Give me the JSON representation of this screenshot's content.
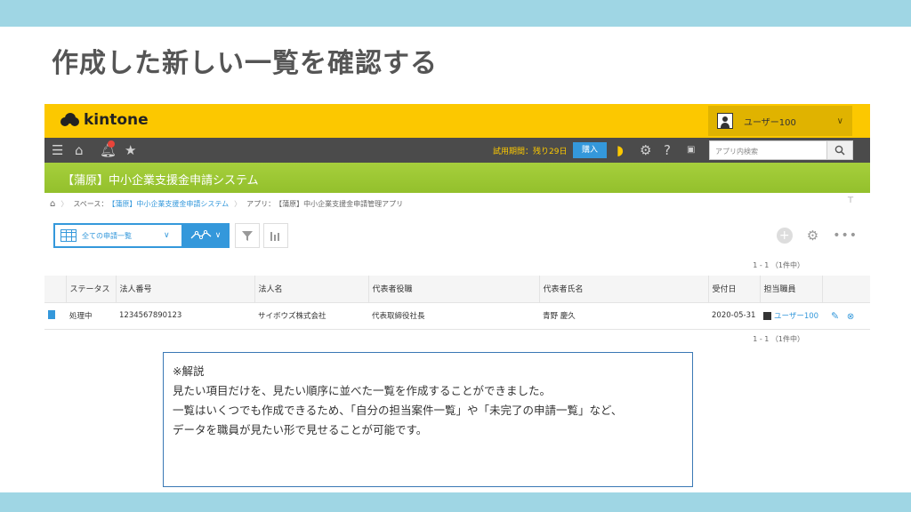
{
  "slide": {
    "title": "作成した新しい一覧を確認する"
  },
  "app": {
    "logo_text": "kintone",
    "user_name": "ユーザー100",
    "trial_text": "試用期間：残り29日",
    "buy_label": "購入",
    "search_placeholder": "アプリ内検索",
    "space_title": "【蒲原】中小企業支援金申請システム",
    "breadcrumb": {
      "space": "スペース：",
      "space_link": "【蒲原】中小企業支援金申請システム",
      "app": "アプリ：",
      "app_link": "【蒲原】中小企業支援金申請管理アプリ"
    },
    "view_label": "全ての申請一覧",
    "pager_top": "1 - 1 （1件中）",
    "pager_bottom": "1 - 1 （1件中）",
    "table": {
      "headers": [
        "ステータス",
        "法人番号",
        "法人名",
        "代表者役職",
        "代表者氏名",
        "受付日",
        "担当職員"
      ],
      "rows": [
        {
          "status": "処理中",
          "corp_number": "1234567890123",
          "corp_name": "サイボウズ株式会社",
          "rep_title": "代表取締役社長",
          "rep_name": "青野 慶久",
          "date": "2020-05-31",
          "staff": "ユーザー100"
        }
      ]
    },
    "colors": {
      "brand_yellow": "#fcc800",
      "accent_blue": "#3498db",
      "space_green": "#93c02c",
      "nav_dark": "#4b4b4b"
    }
  },
  "note": {
    "heading": "※解説",
    "line1": "見たい項目だけを、見たい順序に並べた一覧を作成することができました。",
    "line2": "一覧はいくつでも作成できるため、「自分の担当案件一覧」や「未完了の申請一覧」など、",
    "line3": "データを職員が見たい形で見せることが可能です。"
  }
}
